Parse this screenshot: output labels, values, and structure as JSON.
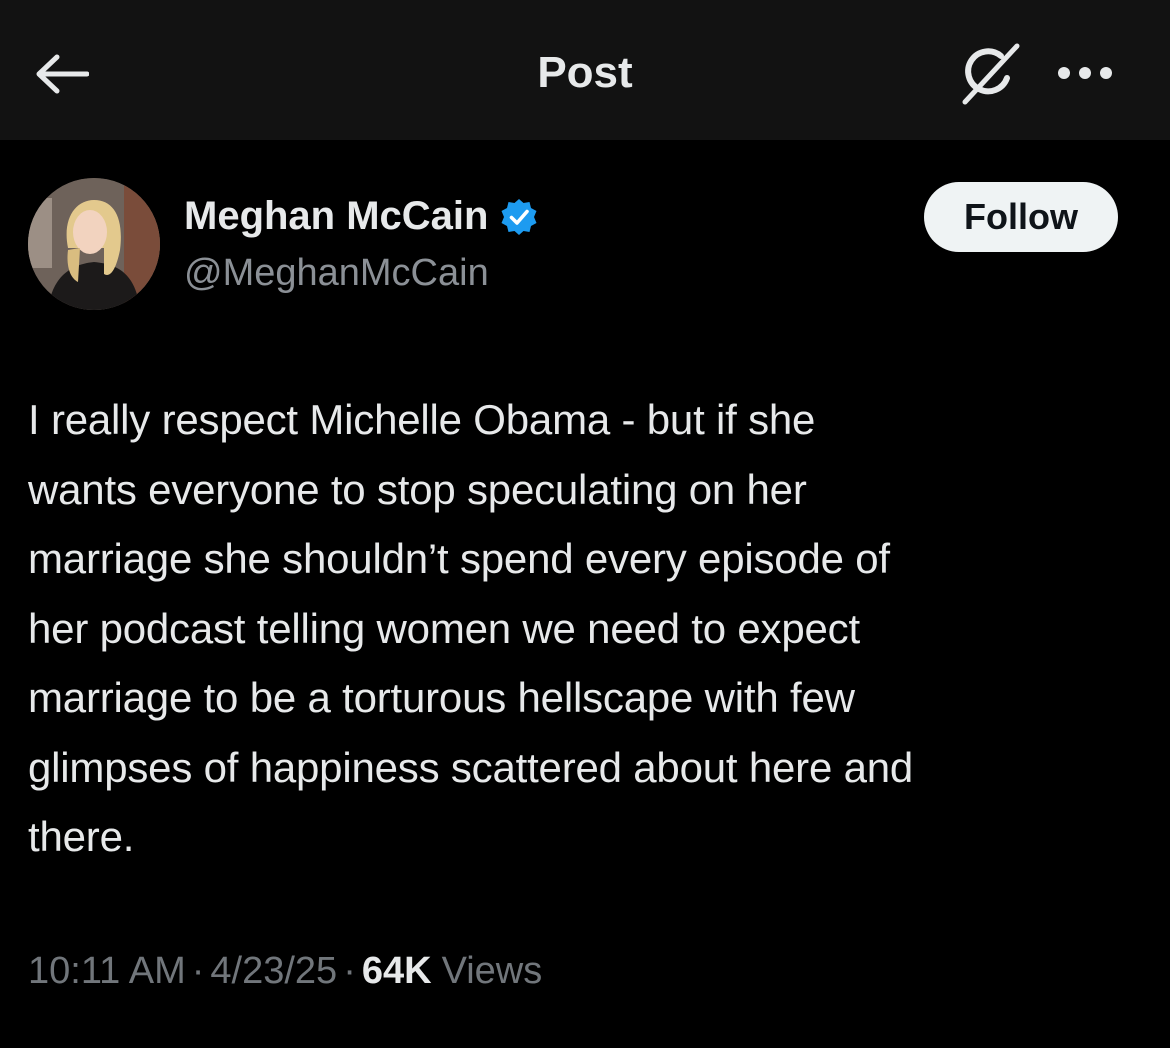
{
  "header": {
    "title": "Post",
    "back_icon": "arrow-left-icon",
    "grok_icon": "grok-icon",
    "more_icon": "more-horizontal-icon"
  },
  "post": {
    "author": {
      "name": "Meghan McCain",
      "handle": "@MeghanMcCain",
      "verified": true,
      "verified_color": "#1d9bf0"
    },
    "follow_label": "Follow",
    "lines": [
      "I really respect Michelle Obama - but if she",
      "wants everyone to stop speculating on her",
      "marriage she shouldn’t spend every episode of",
      "her podcast telling women we need to expect",
      "marriage to be a torturous hellscape with few",
      "glimpses of happiness scattered about here and",
      "there."
    ],
    "time": "10:11 AM",
    "date": "4/23/25",
    "separator": "·",
    "views_count": "64K",
    "views_label": "Views"
  },
  "colors": {
    "background": "#000000",
    "topbar": "#121212",
    "text": "#e7e9ea",
    "secondary": "#71767b",
    "follow_bg": "#eff3f4"
  }
}
